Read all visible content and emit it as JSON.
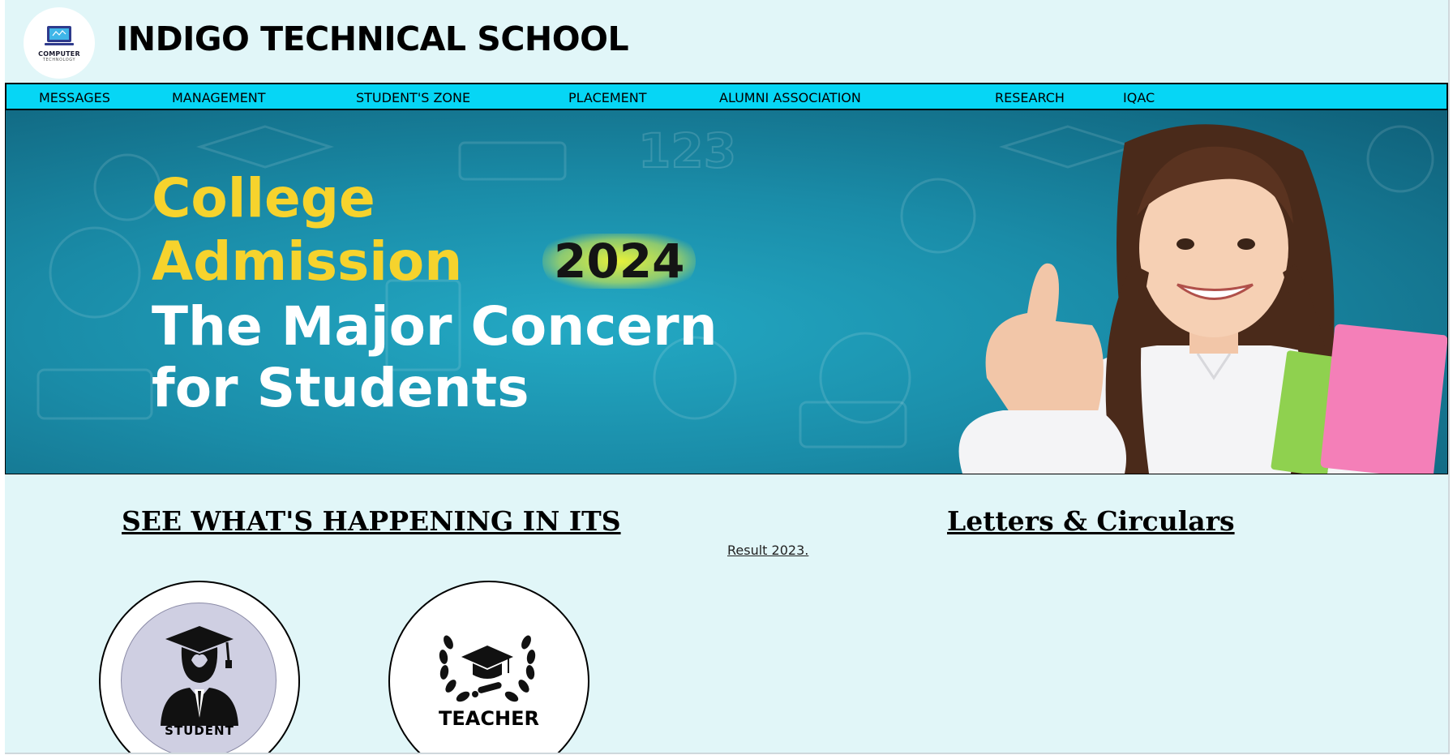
{
  "header": {
    "logo": {
      "icon": "computer-technology-logo",
      "text": "COMPUTER",
      "subtext": "TECHNOLOGY"
    },
    "title": "INDIGO TECHNICAL SCHOOL"
  },
  "nav": {
    "items": [
      {
        "label": "MESSAGES"
      },
      {
        "label": "MANAGEMENT"
      },
      {
        "label": "STUDENT'S ZONE"
      },
      {
        "label": "PLACEMENT"
      },
      {
        "label": "ALUMNI ASSOCIATION"
      },
      {
        "label": "RESEARCH"
      },
      {
        "label": "IQAC"
      }
    ]
  },
  "banner": {
    "line1": "College",
    "line2": "Admission",
    "year": "2024",
    "line3": "The Major Concern",
    "line4": "for Students",
    "image": "girl-thumbs-up-photo",
    "number_doodle": "123"
  },
  "sections": {
    "happening_title": "SEE WHAT'S HAPPENING IN ITS",
    "letters_title": "Letters & Circulars",
    "result_link": "Result 2023."
  },
  "cards": {
    "student": {
      "label": "STUDENT",
      "icon": "graduate-student-icon"
    },
    "teacher": {
      "label": "TEACHER",
      "icon": "laurel-graduation-cap-icon"
    }
  },
  "colors": {
    "page_bg": "#e1f6f8",
    "nav_bg": "#06d6f5",
    "banner_yellow": "#f6d32d",
    "banner_teal": "#1a8ca8"
  }
}
